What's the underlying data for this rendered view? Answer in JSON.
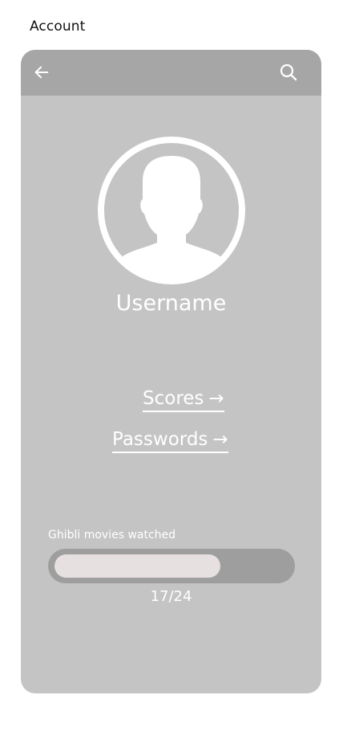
{
  "page": {
    "title": "Account"
  },
  "header": {
    "back_icon": "arrow-left-icon",
    "search_icon": "search-icon"
  },
  "profile": {
    "avatar_icon": "user-silhouette-icon",
    "username": "Username"
  },
  "links": {
    "scores": {
      "label": "Scores",
      "arrow": "→"
    },
    "passwords": {
      "label": "Passwords",
      "arrow": "→"
    }
  },
  "progress": {
    "label": "Ghibli movies watched",
    "count_text": "17/24",
    "watched": 17,
    "total": 24,
    "fraction": 0.708
  },
  "colors": {
    "phone_bg": "#c4c4c4",
    "top_bar": "#a6a6a6",
    "track": "#9e9e9e",
    "fill": "#e6e0e0",
    "foreground": "#ffffff"
  }
}
